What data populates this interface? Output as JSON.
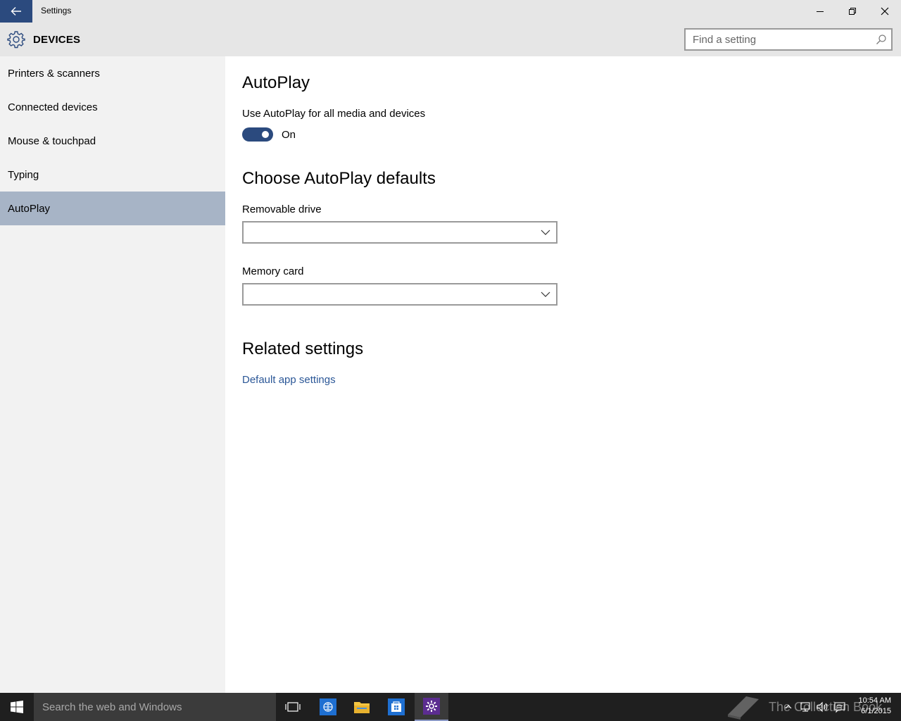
{
  "titlebar": {
    "title": "Settings",
    "icons": {
      "back": "back-arrow-icon",
      "minimize": "minimize-icon",
      "maximize": "restore-icon",
      "close": "close-icon"
    }
  },
  "header": {
    "title": "DEVICES",
    "icon": "gear-icon",
    "search_placeholder": "Find a setting"
  },
  "sidebar": {
    "items": [
      {
        "label": "Printers & scanners",
        "selected": false
      },
      {
        "label": "Connected devices",
        "selected": false
      },
      {
        "label": "Mouse & touchpad",
        "selected": false
      },
      {
        "label": "Typing",
        "selected": false
      },
      {
        "label": "AutoPlay",
        "selected": true
      }
    ]
  },
  "main": {
    "title": "AutoPlay",
    "toggle_label": "Use AutoPlay for all media and devices",
    "toggle_state": "On",
    "defaults_heading": "Choose AutoPlay defaults",
    "removable_label": "Removable drive",
    "removable_value": "",
    "memory_label": "Memory card",
    "memory_value": "",
    "related_heading": "Related settings",
    "related_link": "Default app settings"
  },
  "taskbar": {
    "search_placeholder": "Search the web and Windows",
    "watermark": "The Collection Book",
    "time": "10:54 AM",
    "date": "6/1/2015",
    "apps": [
      "task-view-icon",
      "edge-icon",
      "file-explorer-icon",
      "store-icon",
      "settings-icon"
    ]
  },
  "colors": {
    "accent": "#2b4a7e",
    "sidebar_selected": "#a7b4c6",
    "sidebar_bg": "#f2f2f2",
    "link": "#2b5797",
    "taskbar": "#1f1f1f"
  }
}
